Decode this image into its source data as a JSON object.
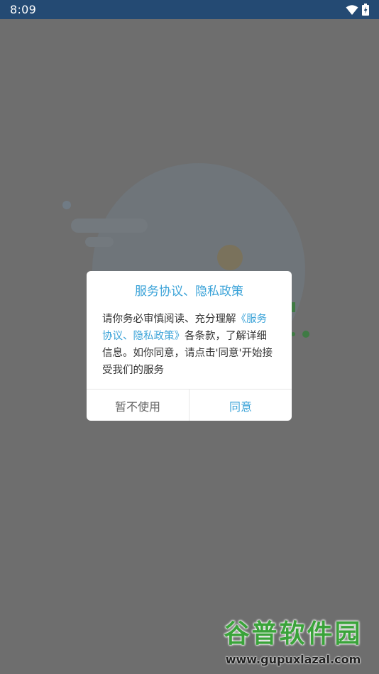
{
  "status_bar": {
    "time": "8:09",
    "icons": [
      "wifi-icon",
      "battery-charging-icon"
    ]
  },
  "dialog": {
    "title": "服务协议、隐私政策",
    "body_before": "请你务必审慎阅读、充分理解",
    "body_link": "《服务协议、隐私政策》",
    "body_after": "各条款，了解详细信息。如你同意，请点击'同意'开始接受我们的服务",
    "decline_label": "暂不使用",
    "agree_label": "同意"
  },
  "watermark": {
    "name": "谷普软件园",
    "url": "www.gupuxlazal.com"
  },
  "colors": {
    "status_bar": "#244a73",
    "accent": "#3ba3d8",
    "overlay": "#6e6e6e"
  }
}
